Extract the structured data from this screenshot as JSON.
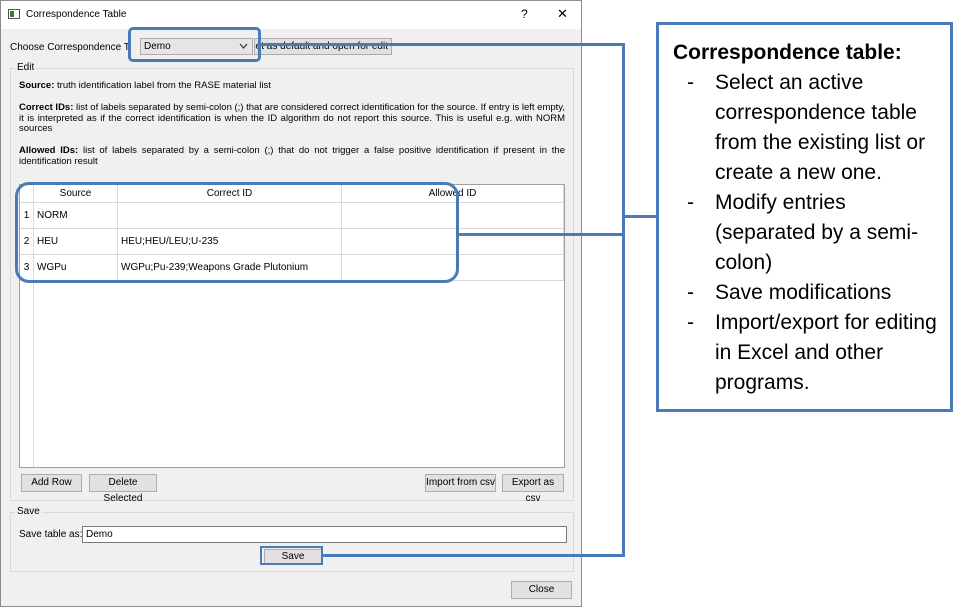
{
  "window": {
    "title": "Correspondence Table",
    "help_label": "?",
    "close_label": "✕"
  },
  "chooser": {
    "label": "Choose Correspondence Tabl",
    "selected": "Demo",
    "set_default_label": "Set as default and open for edit"
  },
  "edit": {
    "group_label": "Edit",
    "source_title": "Source:",
    "source_text": " truth identification label from the RASE material list",
    "correct_title": "Correct IDs:",
    "correct_text": " list of labels separated by semi-colon (;) that are considered correct identification for the source. If entry is left empty, it is interpreted as if the correct identification is when the ID algorithm do not report this source. This is useful e.g. with NORM sources",
    "allowed_title": "Allowed IDs:",
    "allowed_text": " list of labels separated by a semi-colon (;) that do not trigger a false positive identification if present in the identification result"
  },
  "table": {
    "columns": [
      "Source",
      "Correct ID",
      "Allowed ID"
    ],
    "rows": [
      {
        "num": "1",
        "source": "NORM",
        "correct": "",
        "allowed": ""
      },
      {
        "num": "2",
        "source": "HEU",
        "correct": "HEU;HEU/LEU;U-235",
        "allowed": ""
      },
      {
        "num": "3",
        "source": "WGPu",
        "correct": "WGPu;Pu-239;Weapons Grade Plutonium",
        "allowed": ""
      }
    ]
  },
  "buttons": {
    "add_row": "Add Row",
    "delete_selected": "Delete Selected",
    "import_csv": "Import from csv",
    "export_csv": "Export as csv",
    "save": "Save",
    "close": "Close"
  },
  "save_group": {
    "group_label": "Save",
    "field_label": "Save table as:",
    "field_value": "Demo"
  },
  "annotation": {
    "title": "Correspondence table:",
    "items": [
      "Select an active correspondence table from the existing list or create a new one.",
      "Modify entries (separated by a semi-colon)",
      "Save modifications",
      "Import/export for editing in Excel and other programs."
    ]
  },
  "colors": {
    "accent": "#4a7bb7",
    "dialog_bg": "#f0f0f0",
    "button_bg": "#e1e1e1"
  }
}
